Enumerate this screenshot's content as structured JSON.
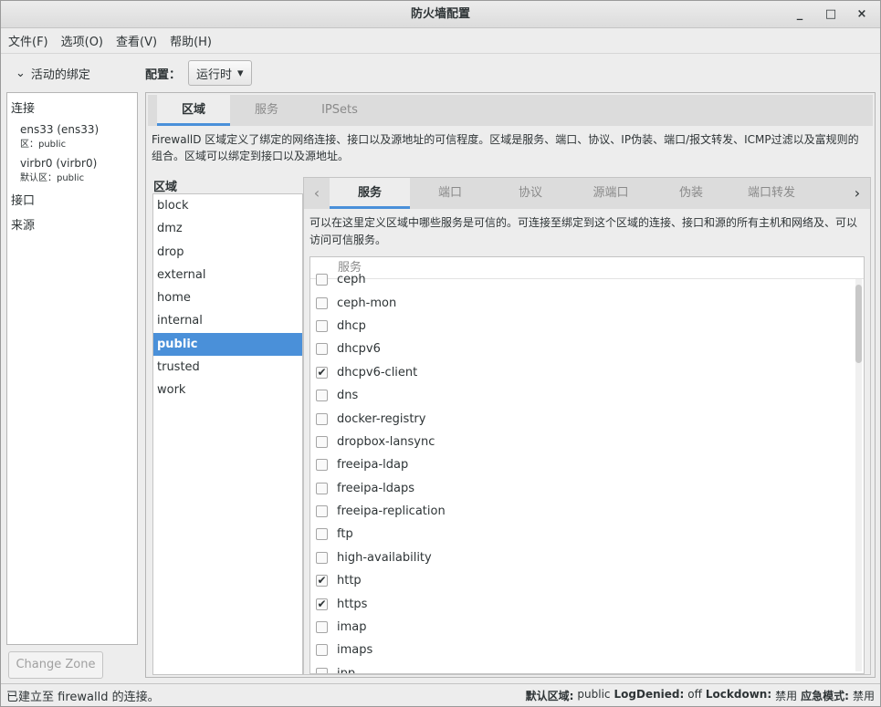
{
  "window": {
    "title": "防火墙配置",
    "controls": [
      "_",
      "□",
      "×"
    ]
  },
  "menu": {
    "items": [
      "文件(F)",
      "选项(O)",
      "查看(V)",
      "帮助(H)"
    ]
  },
  "left_panel": {
    "header": "活动的绑定",
    "connections_label": "连接",
    "connections": [
      {
        "name": "ens33 (ens33)",
        "zone": "区：public"
      },
      {
        "name": "virbr0 (virbr0)",
        "zone": "默认区：public"
      }
    ],
    "interfaces_label": "接口",
    "sources_label": "来源",
    "change_zone_button": "Change Zone"
  },
  "config": {
    "label": "配置：",
    "selected": "运行时"
  },
  "top_tabs": [
    "区域",
    "服务",
    "IPSets"
  ],
  "zone_description": "FirewallD 区域定义了绑定的网络连接、接口以及源地址的可信程度。区域是服务、端口、协议、IP伪装、端口/报文转发、ICMP过滤以及富规则的组合。区域可以绑定到接口以及源地址。",
  "zones": {
    "label": "区域",
    "items": [
      "block",
      "dmz",
      "drop",
      "external",
      "home",
      "internal",
      "public",
      "trusted",
      "work"
    ],
    "selected": "public"
  },
  "inner_tabs": [
    "服务",
    "端口",
    "协议",
    "源端口",
    "伪装",
    "端口转发"
  ],
  "service_description": "可以在这里定义区域中哪些服务是可信的。可连接至绑定到这个区域的连接、接口和源的所有主机和网络及、可以访问可信服务。",
  "services": {
    "header": "服务",
    "items": [
      {
        "name": "ceph",
        "checked": false
      },
      {
        "name": "ceph-mon",
        "checked": false
      },
      {
        "name": "dhcp",
        "checked": false
      },
      {
        "name": "dhcpv6",
        "checked": false
      },
      {
        "name": "dhcpv6-client",
        "checked": true
      },
      {
        "name": "dns",
        "checked": false
      },
      {
        "name": "docker-registry",
        "checked": false
      },
      {
        "name": "dropbox-lansync",
        "checked": false
      },
      {
        "name": "freeipa-ldap",
        "checked": false
      },
      {
        "name": "freeipa-ldaps",
        "checked": false
      },
      {
        "name": "freeipa-replication",
        "checked": false
      },
      {
        "name": "ftp",
        "checked": false
      },
      {
        "name": "high-availability",
        "checked": false
      },
      {
        "name": "http",
        "checked": true
      },
      {
        "name": "https",
        "checked": true
      },
      {
        "name": "imap",
        "checked": false
      },
      {
        "name": "imaps",
        "checked": false
      },
      {
        "name": "ipp",
        "checked": false
      }
    ]
  },
  "statusbar": {
    "message": "已建立至 firewalld 的连接。",
    "default_zone_label": "默认区域:",
    "default_zone_value": "public",
    "log_denied_label": "LogDenied:",
    "log_denied_value": "off",
    "lockdown_label": "Lockdown:",
    "lockdown_value": "禁用",
    "panic_label": "应急模式:",
    "panic_value": "禁用"
  },
  "colors": {
    "accent": "#4a90d9",
    "selected_text": "#ffffff"
  }
}
